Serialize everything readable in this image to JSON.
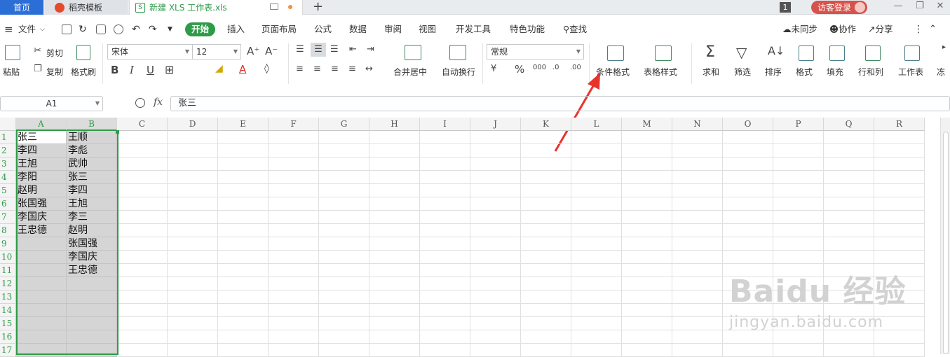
{
  "tabs": {
    "home": "首页",
    "template": "稻壳模板",
    "file": "新建 XLS 工作表.xls",
    "file_icon_letter": "S",
    "new_tab": "+"
  },
  "titlebar": {
    "badge": "1",
    "login": "访客登录"
  },
  "menu": {
    "file": "文件",
    "items": [
      "开始",
      "插入",
      "页面布局",
      "公式",
      "数据",
      "审阅",
      "视图",
      "开发工具",
      "特色功能"
    ],
    "search": "查找",
    "unsync": "未同步",
    "collab": "协作",
    "share": "分享"
  },
  "ribbon": {
    "paste": "粘贴",
    "cut": "剪切",
    "copy": "复制",
    "format_painter": "格式刷",
    "font_name": "宋体",
    "font_size": "12",
    "merge_center": "合并居中",
    "wrap": "自动换行",
    "number_format": "常规",
    "cond_format": "条件格式",
    "table_style": "表格样式",
    "sum": "求和",
    "filter": "筛选",
    "sort": "排序",
    "format": "格式",
    "fill": "填充",
    "row_col": "行和列",
    "worksheet": "工作表",
    "more": "冻"
  },
  "formula_bar": {
    "name_box": "A1",
    "fx": "fx",
    "value": "张三"
  },
  "sheet": {
    "columns": [
      "A",
      "B",
      "C",
      "D",
      "E",
      "F",
      "G",
      "H",
      "I",
      "J",
      "K",
      "L",
      "M",
      "N",
      "O",
      "P",
      "Q",
      "R"
    ],
    "rows": [
      "1",
      "2",
      "3",
      "4",
      "5",
      "6",
      "7",
      "8",
      "9",
      "10",
      "11",
      "12",
      "13",
      "14",
      "15",
      "16",
      "17"
    ],
    "col_a": [
      "张三",
      "李四",
      "王旭",
      "李阳",
      "赵明",
      "张国强",
      "李国庆",
      "王忠德"
    ],
    "col_b": [
      "王顺",
      "李彪",
      "武帅",
      "张三",
      "李四",
      "王旭",
      "李三",
      "赵明",
      "张国强",
      "李国庆",
      "王忠德"
    ]
  },
  "watermark": {
    "main": "Baidu 经验",
    "sub": "jingyan.baidu.com"
  },
  "colors": {
    "accent": "#2e9b49",
    "home_tab": "#2b6fd6",
    "login": "#d6534c",
    "arrow": "#e8332b"
  }
}
